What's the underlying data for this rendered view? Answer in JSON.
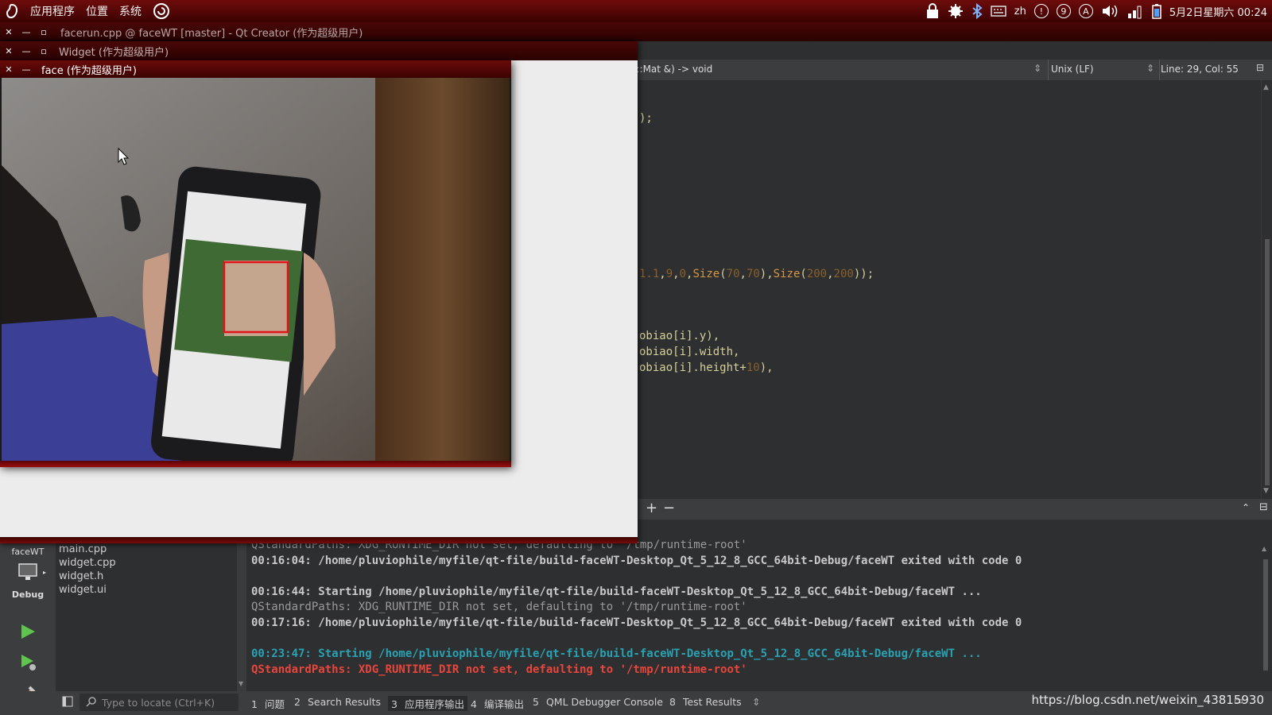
{
  "topbar": {
    "menus": [
      "应用程序",
      "位置",
      "系统"
    ],
    "ime": "zh",
    "tray_circles": [
      "!",
      "9",
      "A"
    ],
    "clock": "5月2日星期六 00:24"
  },
  "windows": {
    "qtcreator_title": "facerun.cpp @ faceWT [master] - Qt Creator (作为超级用户)",
    "widget_title": "Widget (作为超级用户)",
    "face_title": "face (作为超级用户)"
  },
  "editor": {
    "signature": ":v::Mat &) -> void",
    "line_ending": "Unix (LF)",
    "position": "Line: 29, Col: 55",
    "lines": [
      {
        "parts": [
          {
            "t": ");",
            "c": "plain"
          }
        ]
      },
      {
        "parts": [
          {
            "t": "1.1",
            "c": "num"
          },
          {
            "t": ",",
            "c": "plain"
          },
          {
            "t": "9",
            "c": "num"
          },
          {
            "t": ",",
            "c": "plain"
          },
          {
            "t": "0",
            "c": "num"
          },
          {
            "t": ",",
            "c": "plain"
          },
          {
            "t": "Size",
            "c": "fn"
          },
          {
            "t": "(",
            "c": "plain"
          },
          {
            "t": "70",
            "c": "num"
          },
          {
            "t": ",",
            "c": "plain"
          },
          {
            "t": "70",
            "c": "num"
          },
          {
            "t": "),",
            "c": "plain"
          },
          {
            "t": "Size",
            "c": "fn"
          },
          {
            "t": "(",
            "c": "plain"
          },
          {
            "t": "200",
            "c": "num"
          },
          {
            "t": ",",
            "c": "plain"
          },
          {
            "t": "200",
            "c": "num"
          },
          {
            "t": "));",
            "c": "plain"
          }
        ]
      },
      {
        "parts": [
          {
            "t": "obiao[i].y),",
            "c": "plain"
          }
        ]
      },
      {
        "parts": [
          {
            "t": "obiao[i].width,",
            "c": "plain"
          }
        ]
      },
      {
        "parts": [
          {
            "t": "obiao[i].height+",
            "c": "plain"
          },
          {
            "t": "10",
            "c": "num"
          },
          {
            "t": "),",
            "c": "plain"
          }
        ]
      }
    ]
  },
  "output": {
    "lines": [
      {
        "text": "QStandardPaths: XDG_RUNTIME_DIR not set, defaulting to '/tmp/runtime-root'",
        "style": "dim"
      },
      {
        "text": "00:16:04: /home/pluviophile/myfile/qt-file/build-faceWT-Desktop_Qt_5_12_8_GCC_64bit-Debug/faceWT exited with code 0",
        "style": "bold"
      },
      {
        "text": "",
        "style": "dim"
      },
      {
        "text": "00:16:44: Starting /home/pluviophile/myfile/qt-file/build-faceWT-Desktop_Qt_5_12_8_GCC_64bit-Debug/faceWT ...",
        "style": "bold"
      },
      {
        "text": "QStandardPaths: XDG_RUNTIME_DIR not set, defaulting to '/tmp/runtime-root'",
        "style": "dim"
      },
      {
        "text": "00:17:16: /home/pluviophile/myfile/qt-file/build-faceWT-Desktop_Qt_5_12_8_GCC_64bit-Debug/faceWT exited with code 0",
        "style": "bold"
      },
      {
        "text": "",
        "style": "dim"
      },
      {
        "text": "00:23:47: Starting /home/pluviophile/myfile/qt-file/build-faceWT-Desktop_Qt_5_12_8_GCC_64bit-Debug/faceWT ...",
        "style": "teal"
      },
      {
        "text": "QStandardPaths: XDG_RUNTIME_DIR not set, defaulting to '/tmp/runtime-root'",
        "style": "red"
      }
    ],
    "colors": {
      "dim": "#9a9a9a",
      "bold": "#c8c8c8",
      "teal": "#2aa1b3",
      "red": "#e8453c"
    }
  },
  "sidebar": {
    "project": "faceWT",
    "mode": "Debug"
  },
  "files": [
    "main.cpp",
    "widget.cpp",
    "widget.h",
    "widget.ui"
  ],
  "statusbar": {
    "locate_placeholder": "Type to locate (Ctrl+K)",
    "tabs": [
      {
        "n": "1",
        "label": "问题"
      },
      {
        "n": "2",
        "label": "Search Results"
      },
      {
        "n": "3",
        "label": "应用程序输出"
      },
      {
        "n": "4",
        "label": "编译输出"
      },
      {
        "n": "5",
        "label": "QML Debugger Console"
      },
      {
        "n": "8",
        "label": "Test Results"
      }
    ]
  },
  "watermark": "https://blog.csdn.net/weixin_43815930"
}
